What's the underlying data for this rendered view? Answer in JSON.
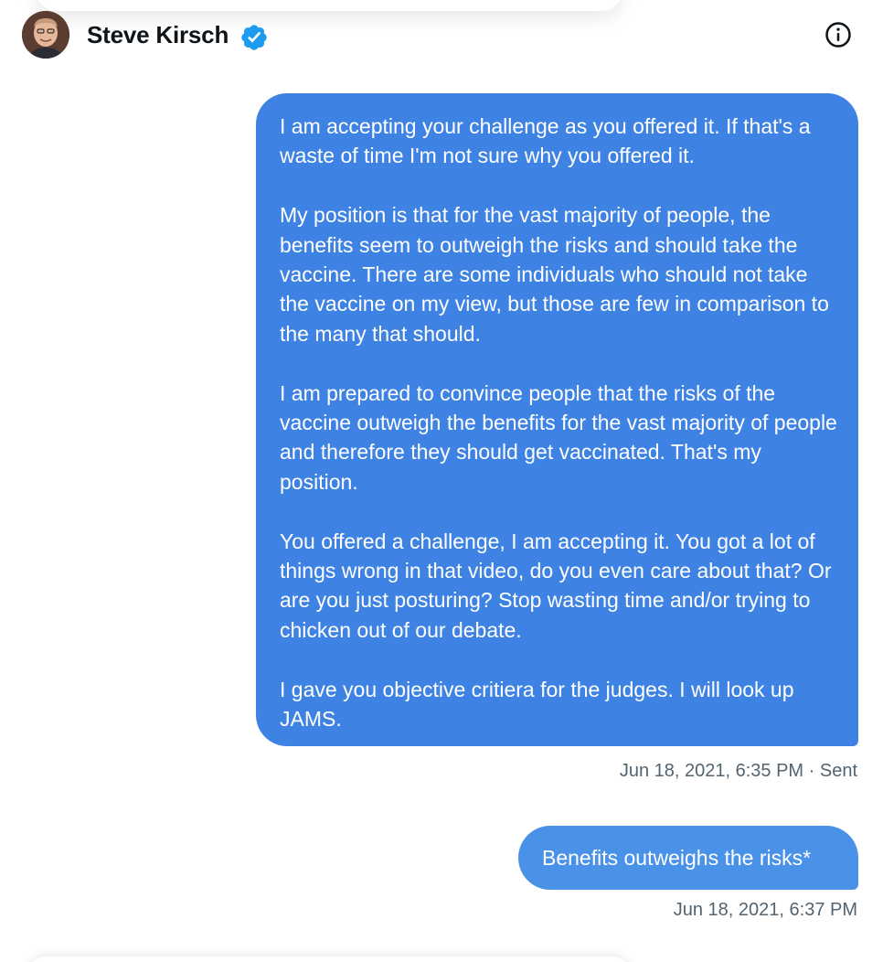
{
  "header": {
    "contact_name": "Steve Kirsch",
    "verified_icon": "verified-badge-icon",
    "info_icon": "info-icon"
  },
  "colors": {
    "bubble_primary": "#3e82e3",
    "bubble_secondary": "#4a92e8",
    "verified": "#1d9bf0",
    "meta_text": "#536471"
  },
  "messages": [
    {
      "paragraphs": [
        "I am accepting your challenge as you offered it. If that's a waste of time I'm not sure why you offered it.",
        "My position is that for the vast majority of people, the benefits seem to outweigh the risks and should take the vaccine. There are some individuals who should not take the vaccine on my view, but those are few in comparison to the many that should.",
        "I am prepared to convince people that the risks of the vaccine outweigh the benefits for the vast majority of people and therefore they should get vaccinated. That's my position.",
        "You offered a challenge, I am accepting it. You got a lot of things wrong in that video, do you even care about that? Or are you just posturing? Stop wasting time and/or trying to chicken out of our debate.",
        "I gave you objective critiera for the judges. I will look up JAMS."
      ],
      "meta": "Jun 18, 2021, 6:35 PM · Sent"
    },
    {
      "text": "Benefits outweighs the risks*",
      "meta": "Jun 18, 2021, 6:37 PM"
    }
  ]
}
